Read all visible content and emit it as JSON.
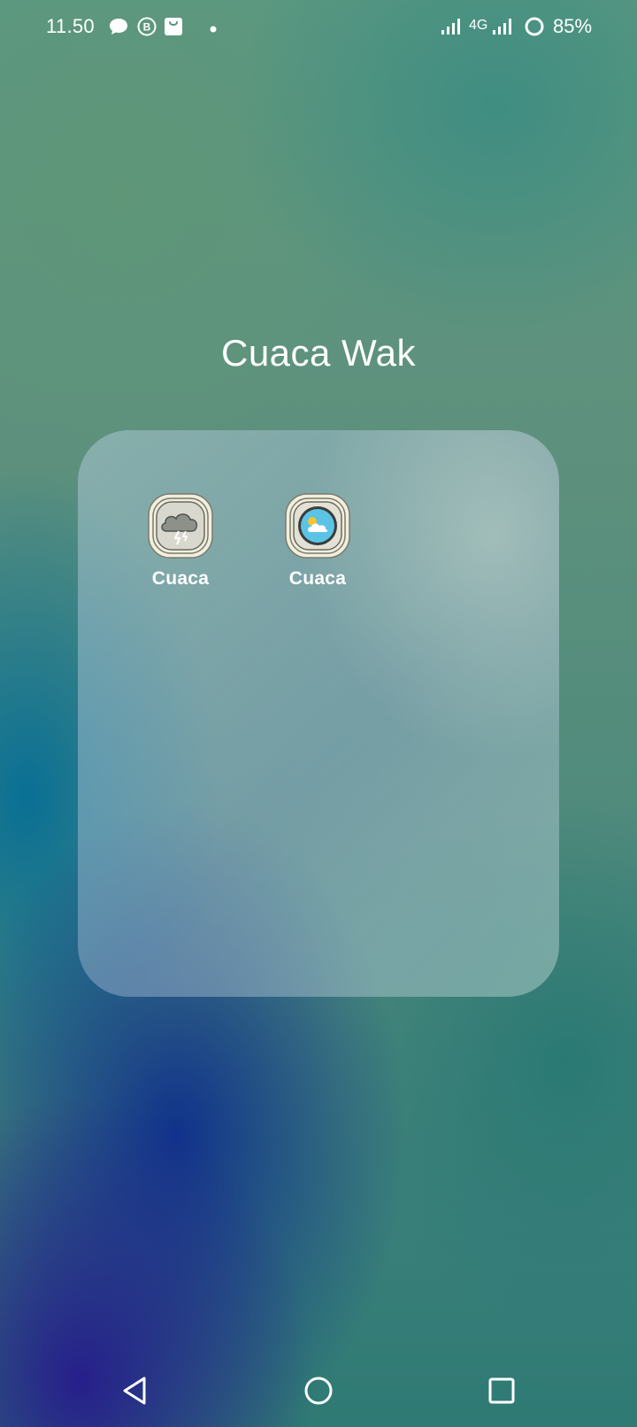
{
  "status_bar": {
    "time": "11.50",
    "notification_icons": [
      "chat-bubble-icon",
      "b-circle-icon",
      "shopping-bag-icon",
      "dot-icon"
    ],
    "network_label": "4G",
    "battery": "85%"
  },
  "folder": {
    "title": "Cuaca Wak",
    "apps": [
      {
        "label": "Cuaca",
        "icon": "storm-cloud-icon"
      },
      {
        "label": "Cuaca",
        "icon": "sun-cloud-icon"
      }
    ]
  },
  "nav_bar": {
    "buttons": [
      "back-triangle-icon",
      "home-circle-icon",
      "recents-square-icon"
    ]
  },
  "colors": {
    "text": "#ffffff",
    "icon_frame": "#f1eedc",
    "weather_blue": "#5bc4e6",
    "sun_yellow": "#f2c431"
  }
}
